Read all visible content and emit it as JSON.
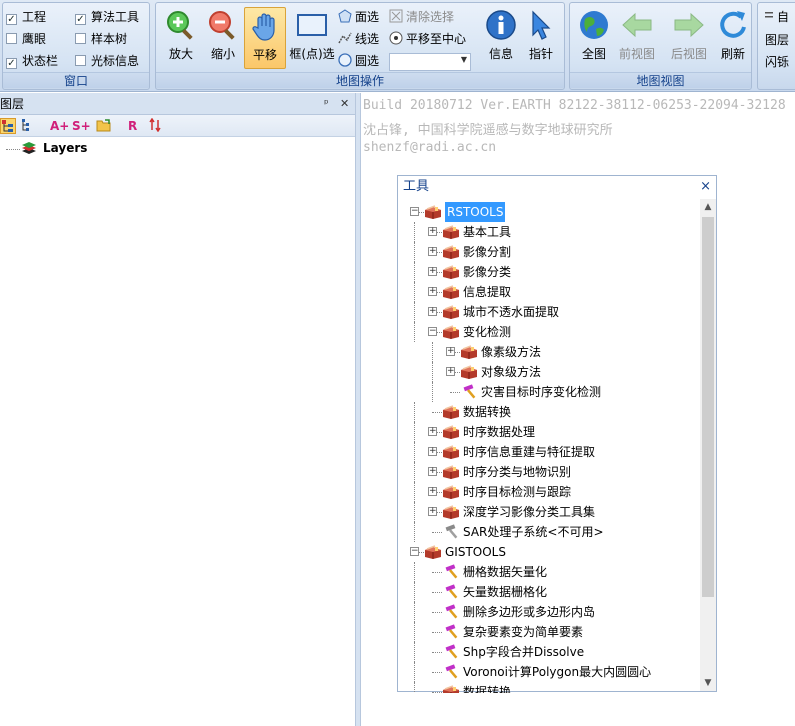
{
  "ribbon": {
    "window_group": {
      "label": "窗口",
      "checks": [
        {
          "label": "工程",
          "checked": true
        },
        {
          "label": "鹰眼",
          "checked": false
        },
        {
          "label": "状态栏",
          "checked": true
        },
        {
          "label": "算法工具",
          "checked": true
        },
        {
          "label": "样本树",
          "checked": false
        },
        {
          "label": "光标信息",
          "checked": false
        }
      ]
    },
    "map_ops_group": {
      "label": "地图操作",
      "zoom_in": "放大",
      "zoom_out": "缩小",
      "pan": "平移",
      "box_select": "框(点)选",
      "polygon_select": "面选",
      "line_select": "线选",
      "circle_select": "圆选",
      "clear_select": "清除选择",
      "pan_to_center": "平移至中心",
      "info": "信息",
      "pointer": "指针",
      "dropdown_value": ""
    },
    "map_view_group": {
      "label": "地图视图",
      "full_view": "全图",
      "prev_view": "前视图",
      "next_view": "后视图",
      "refresh": "刷新"
    },
    "extra_group": {
      "auto": "自",
      "layers": "图层",
      "flash": "闪铄"
    }
  },
  "layers_panel": {
    "title": "图层",
    "pin_icon": "pin-icon",
    "close_icon": "close-icon",
    "toolbar": [
      "A+",
      "S+",
      "R"
    ],
    "root": "Layers"
  },
  "map": {
    "watermark": [
      "Build 20180712 Ver.EARTH 82122-38112-06253-22094-32128",
      "沈占锋, 中国科学院遥感与数字地球研究所",
      "shenzf@radi.ac.cn"
    ]
  },
  "tool_window": {
    "title": "工具",
    "close": "×",
    "tree": [
      {
        "label": "RSTOOLS",
        "level": 0,
        "type": "box",
        "exp": "-",
        "selected": true
      },
      {
        "label": "基本工具",
        "level": 1,
        "type": "box",
        "exp": "+"
      },
      {
        "label": "影像分割",
        "level": 1,
        "type": "box",
        "exp": "+"
      },
      {
        "label": "影像分类",
        "level": 1,
        "type": "box",
        "exp": "+"
      },
      {
        "label": "信息提取",
        "level": 1,
        "type": "box",
        "exp": "+"
      },
      {
        "label": "城市不透水面提取",
        "level": 1,
        "type": "box",
        "exp": "+"
      },
      {
        "label": "变化检测",
        "level": 1,
        "type": "box",
        "exp": "-"
      },
      {
        "label": "像素级方法",
        "level": 2,
        "type": "box",
        "exp": "+"
      },
      {
        "label": "对象级方法",
        "level": 2,
        "type": "box",
        "exp": "+"
      },
      {
        "label": "灾害目标时序变化检测",
        "level": 2,
        "type": "hammer",
        "exp": ""
      },
      {
        "label": "数据转换",
        "level": 1,
        "type": "box",
        "exp": ""
      },
      {
        "label": "时序数据处理",
        "level": 1,
        "type": "box",
        "exp": "+"
      },
      {
        "label": "时序信息重建与特征提取",
        "level": 1,
        "type": "box",
        "exp": "+"
      },
      {
        "label": "时序分类与地物识别",
        "level": 1,
        "type": "box",
        "exp": "+"
      },
      {
        "label": "时序目标检测与跟踪",
        "level": 1,
        "type": "box",
        "exp": "+"
      },
      {
        "label": "深度学习影像分类工具集",
        "level": 1,
        "type": "box",
        "exp": "+"
      },
      {
        "label": "SAR处理子系统<不可用>",
        "level": 1,
        "type": "hammer-gray",
        "exp": ""
      },
      {
        "label": "GISTOOLS",
        "level": 0,
        "type": "box",
        "exp": "-"
      },
      {
        "label": "栅格数据矢量化",
        "level": 1,
        "type": "hammer",
        "exp": ""
      },
      {
        "label": "矢量数据栅格化",
        "level": 1,
        "type": "hammer",
        "exp": ""
      },
      {
        "label": "删除多边形或多边形内岛",
        "level": 1,
        "type": "hammer",
        "exp": ""
      },
      {
        "label": "复杂要素变为简单要素",
        "level": 1,
        "type": "hammer",
        "exp": ""
      },
      {
        "label": "Shp字段合并Dissolve",
        "level": 1,
        "type": "hammer",
        "exp": ""
      },
      {
        "label": "Voronoi计算Polygon最大内圆圆心",
        "level": 1,
        "type": "hammer",
        "exp": ""
      },
      {
        "label": "数据转换",
        "level": 1,
        "type": "box",
        "exp": ""
      }
    ]
  },
  "colors": {
    "ribbon_text": "#15428b",
    "selected_bg": "#3399ff",
    "pan_active": "#fbc76a"
  }
}
